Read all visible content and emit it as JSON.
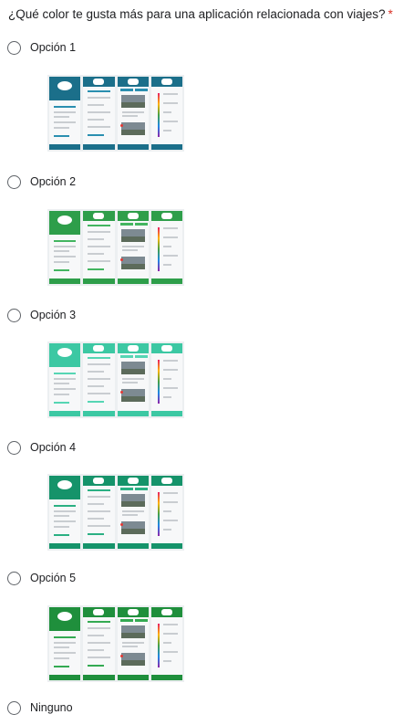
{
  "question": {
    "title": "¿Qué color te gusta más para una aplicación relacionada con viajes?",
    "required_mark": "*"
  },
  "options": [
    {
      "label": "Opción 1",
      "theme": {
        "primary": "#1b6f8a",
        "accent": "#2a8fb0"
      }
    },
    {
      "label": "Opción 2",
      "theme": {
        "primary": "#2e9e4a",
        "accent": "#43b560"
      }
    },
    {
      "label": "Opción 3",
      "theme": {
        "primary": "#3cc8a3",
        "accent": "#56d6b4"
      }
    },
    {
      "label": "Opción 4",
      "theme": {
        "primary": "#15936a",
        "accent": "#2bb083"
      }
    },
    {
      "label": "Opción 5",
      "theme": {
        "primary": "#1f8f3c",
        "accent": "#34aa52"
      }
    },
    {
      "label": "Ninguno"
    }
  ],
  "colors": {
    "text": "#202124",
    "required": "#d93025",
    "radio_border": "#5f6368"
  }
}
